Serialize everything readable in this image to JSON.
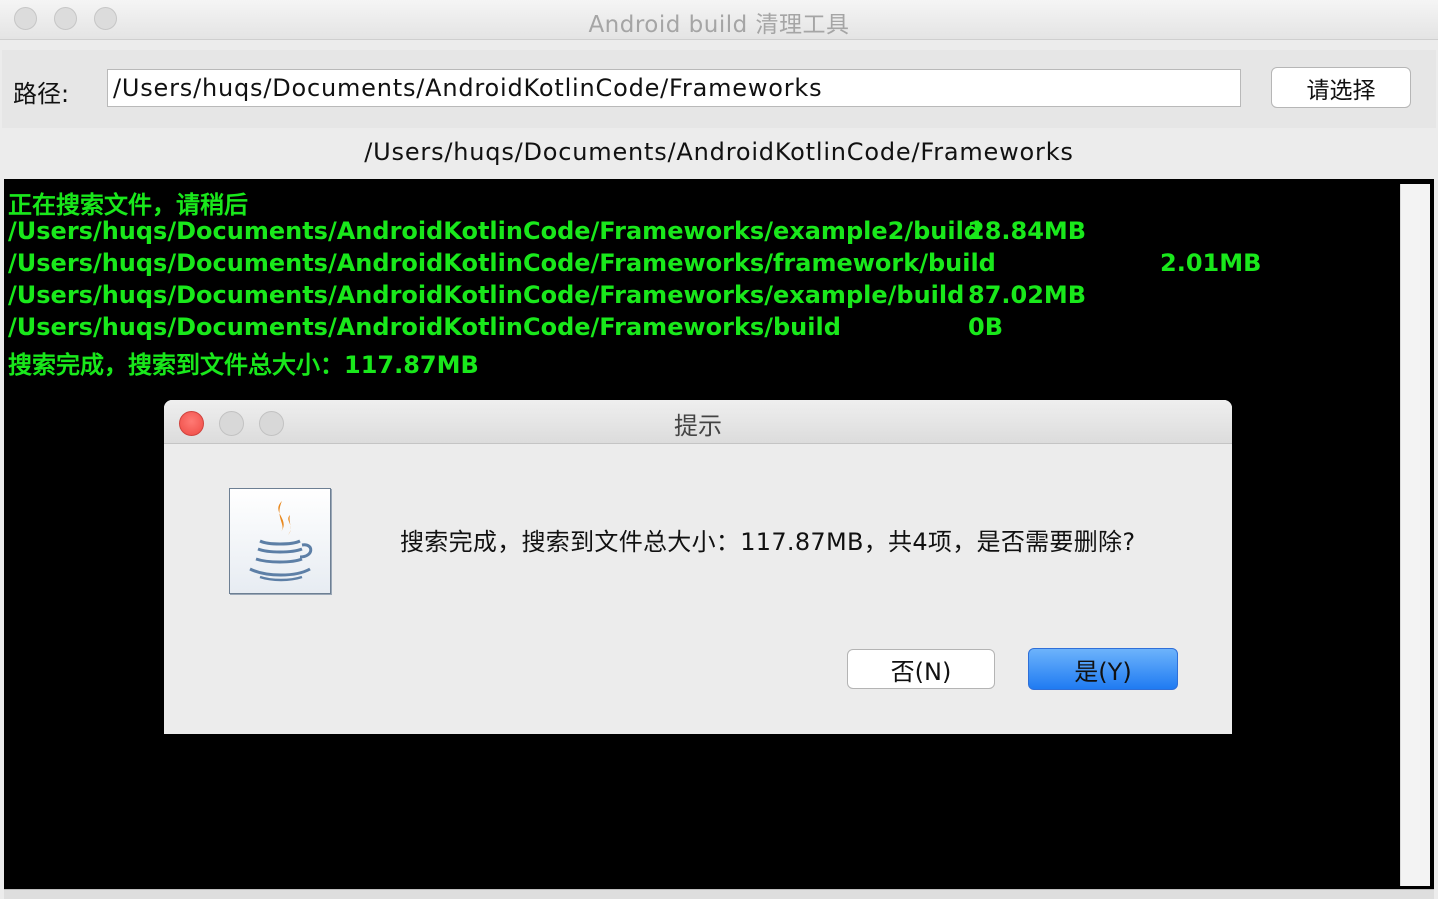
{
  "window": {
    "title": "Android build 清理工具"
  },
  "path_row": {
    "label": "路径:",
    "input_value": "/Users/huqs/Documents/AndroidKotlinCode/Frameworks",
    "choose_button": "请选择"
  },
  "selected_path": "/Users/huqs/Documents/AndroidKotlinCode/Frameworks",
  "console": {
    "text_color": "#19e81b",
    "background": "#000000",
    "status_searching": "正在搜索文件，请稍后",
    "results": [
      {
        "path": "/Users/huqs/Documents/AndroidKotlinCode/Frameworks/example2/build",
        "size": "28.84MB"
      },
      {
        "path": "/Users/huqs/Documents/AndroidKotlinCode/Frameworks/framework/build",
        "size": "2.01MB"
      },
      {
        "path": "/Users/huqs/Documents/AndroidKotlinCode/Frameworks/example/build",
        "size": "87.02MB"
      },
      {
        "path": "/Users/huqs/Documents/AndroidKotlinCode/Frameworks/build",
        "size": "0B"
      }
    ],
    "status_done": "搜索完成，搜索到文件总大小：117.87MB"
  },
  "dialog": {
    "title": "提示",
    "icon": "java-icon",
    "message": "搜索完成，搜索到文件总大小：117.87MB，共4项，是否需要删除?",
    "no_button": "否(N)",
    "yes_button": "是(Y)",
    "close_color": "#fc605c",
    "accent": "#1f7bf2"
  }
}
